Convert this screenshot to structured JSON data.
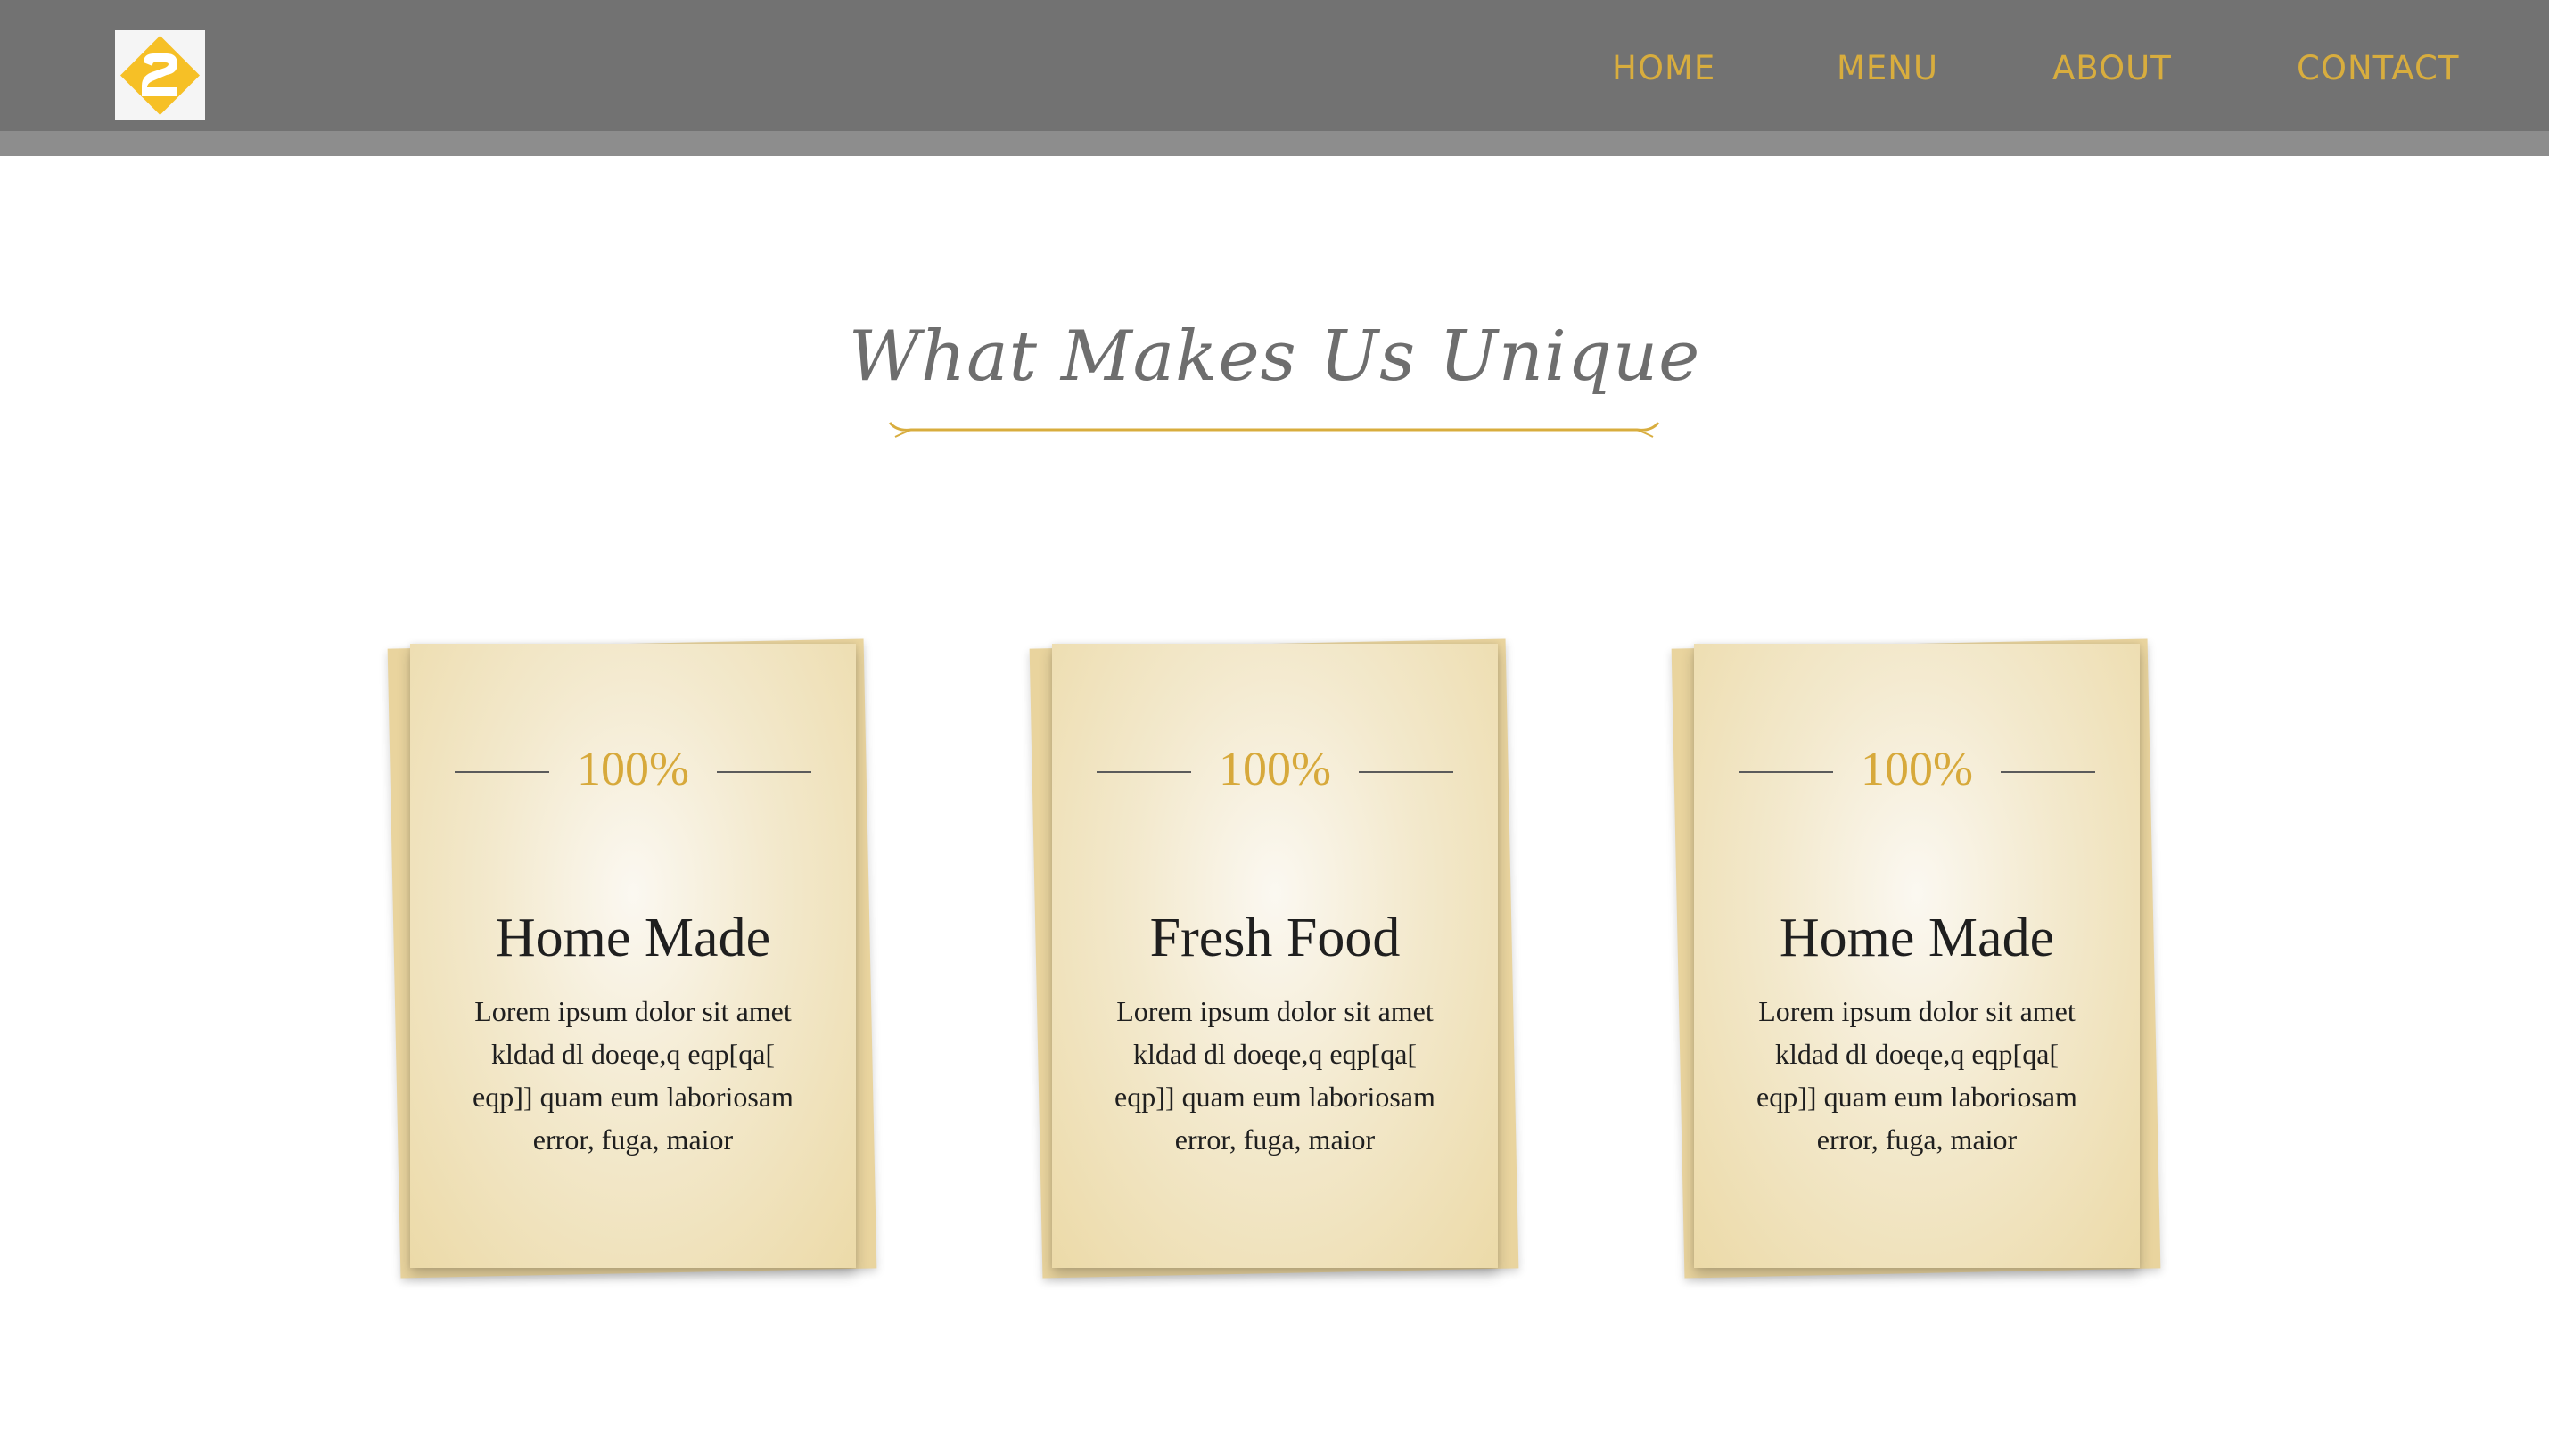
{
  "header": {
    "logo_icon": "logo-2-icon",
    "nav": [
      {
        "label": "HOME"
      },
      {
        "label": "MENU"
      },
      {
        "label": "ABOUT"
      },
      {
        "label": "CONTACT"
      }
    ]
  },
  "section": {
    "title": "What Makes Us Unique"
  },
  "cards": [
    {
      "percent": "100%",
      "title": "Home Made",
      "text": "Lorem ipsum dolor sit amet kldad dl doeqe,q eqp[qa[ eqp]] quam eum laboriosam error, fuga, maior"
    },
    {
      "percent": "100%",
      "title": "Fresh Food",
      "text": "Lorem ipsum dolor sit amet kldad dl doeqe,q eqp[qa[ eqp]] quam eum laboriosam error, fuga, maior"
    },
    {
      "percent": "100%",
      "title": "Home Made",
      "text": "Lorem ipsum dolor sit amet kldad dl doeqe,q eqp[qa[ eqp]] quam eum laboriosam error, fuga, maior"
    }
  ],
  "colors": {
    "header_bg": "#727272",
    "accent_gold": "#d8ad3e",
    "title_gray": "#6e6e6e",
    "card_paper": "#f3e9cd"
  }
}
